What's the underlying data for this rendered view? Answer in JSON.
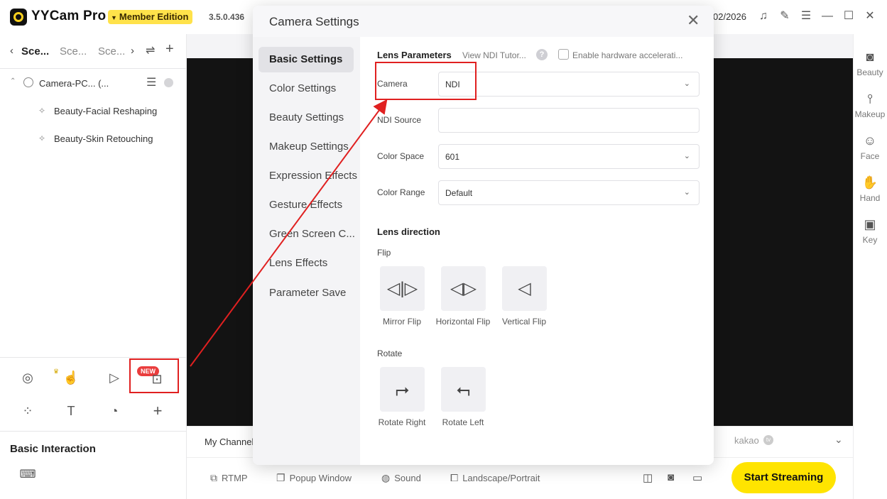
{
  "app": {
    "title": "YYCam Pro",
    "member_label": "Member Edition",
    "version": "3.5.0.436",
    "date": "02/2026"
  },
  "scenes": {
    "tabs": [
      "Sce...",
      "Sce...",
      "Sce..."
    ],
    "tree": {
      "camera_label": "Camera-PC... (...",
      "children": [
        "Beauty-Facial Reshaping",
        "Beauty-Skin Retouching"
      ]
    }
  },
  "tools": {
    "new_badge": "NEW"
  },
  "basic_interaction": "Basic Interaction",
  "channel": {
    "label": "My Channel",
    "kakao": "kakao"
  },
  "bottom_bar": {
    "rtmp": "RTMP",
    "popup": "Popup Window",
    "sound": "Sound",
    "orientation": "Landscape/Portrait",
    "start": "Start Streaming"
  },
  "right_strip": [
    "Beauty",
    "Makeup",
    "Face",
    "Hand",
    "Key"
  ],
  "dialog": {
    "title": "Camera Settings",
    "nav": [
      "Basic Settings",
      "Color Settings",
      "Beauty Settings",
      "Makeup Settings",
      "Expression Effects",
      "Gesture Effects",
      "Green Screen C...",
      "Lens Effects",
      "Parameter Save"
    ],
    "lens_params": "Lens Parameters",
    "ndi_tutorial": "View NDI Tutor...",
    "help": "?",
    "hw_accel": "Enable hardware accelerati...",
    "fields": {
      "camera": {
        "label": "Camera",
        "value": "NDI"
      },
      "ndi_source": {
        "label": "NDI Source",
        "value": ""
      },
      "color_space": {
        "label": "Color Space",
        "value": "601"
      },
      "color_range": {
        "label": "Color Range",
        "value": "Default"
      }
    },
    "lens_direction": "Lens direction",
    "flip_label": "Flip",
    "flip_buttons": [
      "Mirror Flip",
      "Horizontal Flip",
      "Vertical Flip"
    ],
    "rotate_label": "Rotate",
    "rotate_buttons": [
      "Rotate Right",
      "Rotate Left"
    ]
  },
  "colors": {
    "accent_yellow": "#ffe400",
    "highlight_red": "#e02020"
  }
}
